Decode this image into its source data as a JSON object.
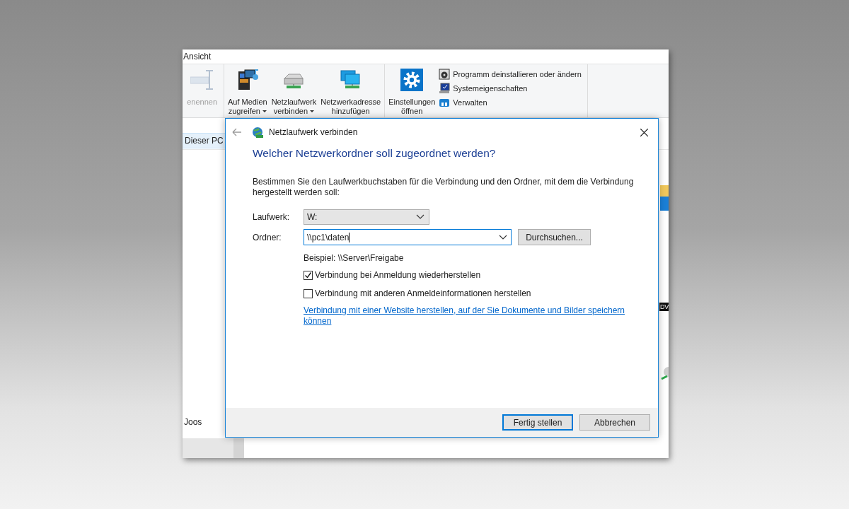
{
  "explorer": {
    "menu_tab": "Ansicht",
    "ribbon_groups": [
      {
        "items": [
          {
            "kind": "large",
            "lines": [
              "enennen"
            ],
            "dropdown": false,
            "disabled": true
          }
        ]
      },
      {
        "items": [
          {
            "kind": "large",
            "lines": [
              "Auf Medien",
              "zugreifen"
            ],
            "dropdown": true,
            "disabled": false
          },
          {
            "kind": "large",
            "lines": [
              "Netzlaufwerk",
              "verbinden"
            ],
            "dropdown": true,
            "disabled": false
          },
          {
            "kind": "large",
            "lines": [
              "Netzwerkadresse",
              "hinzufügen"
            ],
            "dropdown": false,
            "disabled": false
          }
        ]
      },
      {
        "items": [
          {
            "kind": "large",
            "lines": [
              "Einstellungen",
              "öffnen"
            ],
            "dropdown": false,
            "disabled": false
          },
          {
            "kind": "small",
            "lines": [
              "Programm deinstallieren oder ändern"
            ],
            "disabled": false
          },
          {
            "kind": "small",
            "lines": [
              "Systemeigenschaften"
            ],
            "disabled": false
          },
          {
            "kind": "small",
            "lines": [
              "Verwalten"
            ],
            "disabled": false
          }
        ]
      }
    ],
    "breadcrumb": "Dieser PC",
    "nav_items": [
      "Joos"
    ],
    "content_label": "DV"
  },
  "dialog": {
    "title": "Netzlaufwerk verbinden",
    "heading": "Welcher Netzwerkordner soll zugeordnet werden?",
    "intro": "Bestimmen Sie den Laufwerkbuchstaben für die Verbindung und den Ordner, mit dem die Verbindung hergestellt werden soll:",
    "fields": [
      {
        "kind": "dropdown",
        "label": "Laufwerk:",
        "value": "W:",
        "focused": false
      },
      {
        "kind": "combo",
        "label": "Ordner:",
        "value": "\\\\pc1\\daten",
        "focused": true,
        "button": "Durchsuchen..."
      }
    ],
    "example": "Beispiel: \\\\Server\\Freigabe",
    "options": [
      {
        "label": "Verbindung bei Anmeldung wiederherstellen",
        "checked": true
      },
      {
        "label": "Verbindung mit anderen Anmeldeinformationen herstellen",
        "checked": false
      }
    ],
    "link": "Verbindung mit einer Website herstellen, auf der Sie Dokumente und Bilder speichern können",
    "buttons": [
      {
        "label": "Fertig stellen",
        "default": true
      },
      {
        "label": "Abbrechen",
        "default": false
      }
    ]
  }
}
